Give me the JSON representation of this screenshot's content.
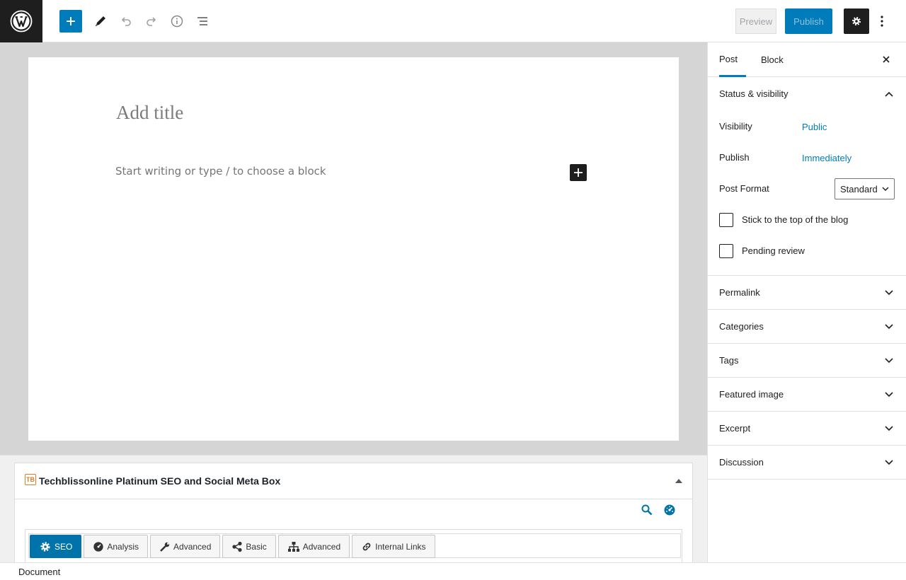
{
  "toolbar": {
    "preview_label": "Preview",
    "publish_label": "Publish"
  },
  "editor": {
    "title_placeholder": "Add title",
    "block_placeholder": "Start writing or type / to choose a block"
  },
  "metabox": {
    "logo_text": "TB",
    "title": "Techblissonline Platinum SEO and Social Meta Box",
    "tabs": [
      {
        "label": "SEO",
        "icon": "gear-icon",
        "active": true
      },
      {
        "label": "Analysis",
        "icon": "dashboard-icon",
        "active": false
      },
      {
        "label": "Advanced",
        "icon": "wrench-icon",
        "active": false
      },
      {
        "label": "Basic",
        "icon": "share-icon",
        "active": false
      },
      {
        "label": "Advanced",
        "icon": "sitemap-icon",
        "active": false
      },
      {
        "label": "Internal Links",
        "icon": "link-icon",
        "active": false
      }
    ]
  },
  "sidebar": {
    "tabs": [
      "Post",
      "Block"
    ],
    "status_panel": {
      "title": "Status & visibility",
      "visibility_label": "Visibility",
      "visibility_value": "Public",
      "publish_label": "Publish",
      "publish_value": "Immediately",
      "format_label": "Post Format",
      "format_value": "Standard",
      "sticky_label": "Stick to the top of the blog",
      "pending_label": "Pending review"
    },
    "panels": [
      "Permalink",
      "Categories",
      "Tags",
      "Featured image",
      "Excerpt",
      "Discussion"
    ]
  },
  "footer": {
    "breadcrumb": "Document"
  },
  "colors": {
    "accent": "#007cba",
    "dark": "#1e1e1e",
    "seo_tab_active": "#0073aa"
  }
}
